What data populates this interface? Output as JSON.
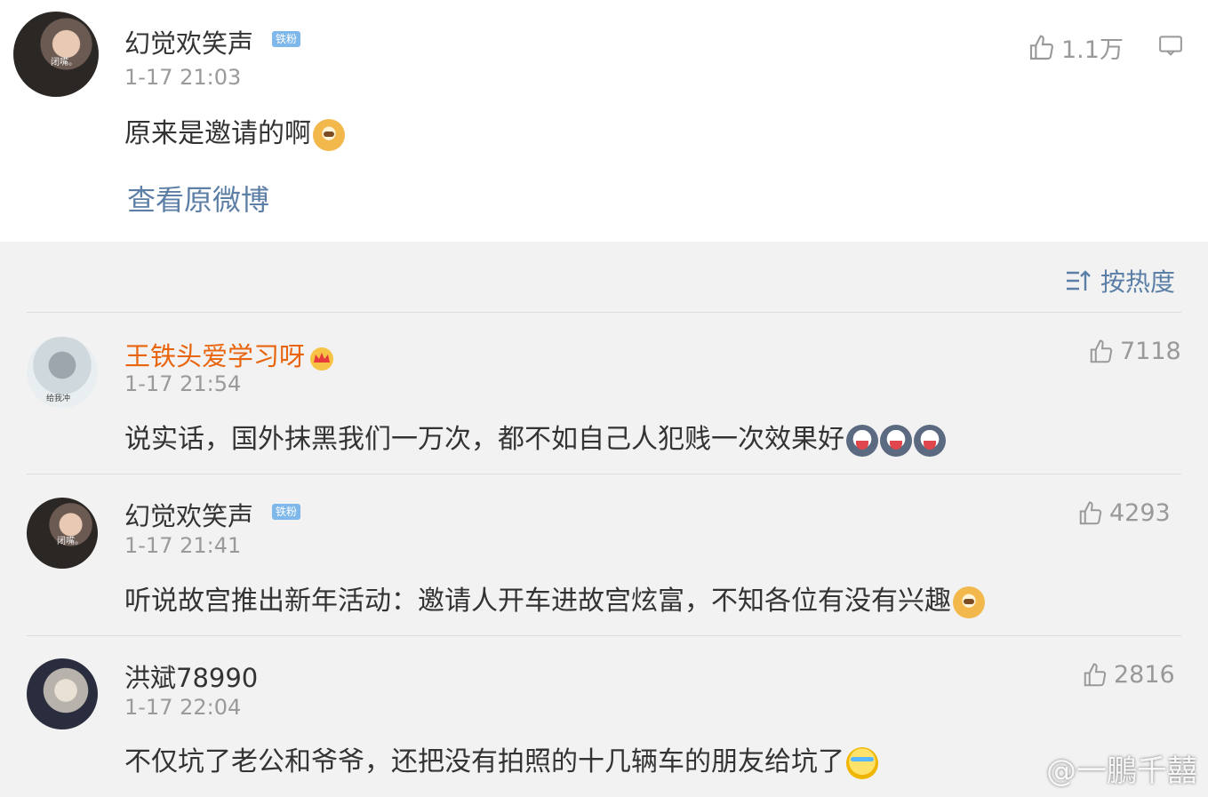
{
  "post": {
    "author": "幻觉欢笑声",
    "badge": "铁粉",
    "avatar_caption": "闭嘴。",
    "time": "1-17 21:03",
    "text": "原来是邀请的啊",
    "emoji": "doge",
    "likes": "1.1万",
    "view_original": "查看原微博"
  },
  "sort": {
    "label": "按热度",
    "icon": "sort-lines-icon"
  },
  "comments": [
    {
      "author": "王铁头爱学习呀",
      "vip": true,
      "crown": "crown-icon",
      "avatar_caption": "给我冲",
      "time": "1-17 21:54",
      "text": "说实话，国外抹黑我们一万次，都不如自己人犯贱一次效果好",
      "emojis": [
        "husky",
        "husky",
        "husky"
      ],
      "likes": "7118"
    },
    {
      "author": "幻觉欢笑声",
      "badge": "铁粉",
      "avatar_caption": "闭嘴。",
      "time": "1-17 21:41",
      "text": "听说故宫推出新年活动：邀请人开车进故宫炫富，不知各位有没有兴趣",
      "emojis": [
        "doge"
      ],
      "likes": "4293"
    },
    {
      "author": "洪斌78990",
      "time": "1-17 22:04",
      "text": "不仅坑了老公和爷爷，还把没有拍照的十几辆车的朋友给坑了",
      "emojis": [
        "cry"
      ],
      "likes": "2816"
    }
  ],
  "watermark": "@一鵬千囍",
  "colors": {
    "link": "#5d7fa6",
    "vip_name": "#e8650e",
    "badge": "#7eb7ea",
    "background": "#f2f2f2"
  }
}
